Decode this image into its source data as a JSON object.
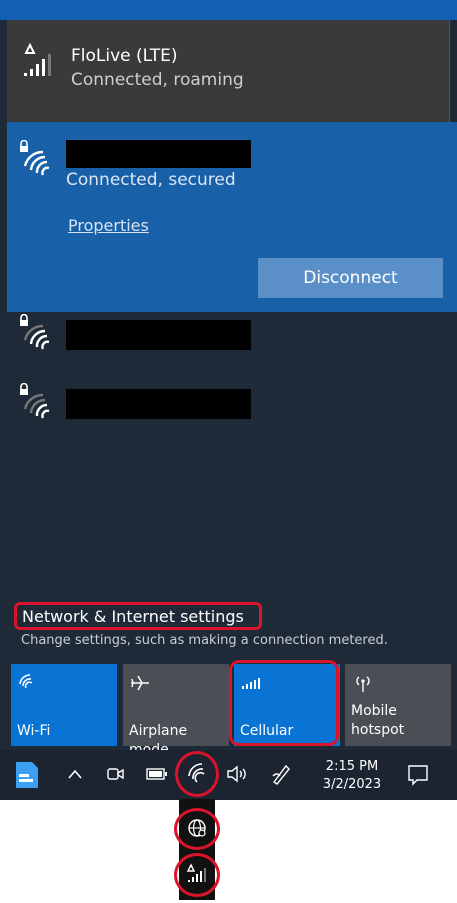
{
  "cellular_connection": {
    "name": "FloLive (LTE)",
    "status": "Connected, roaming"
  },
  "wifi_active": {
    "status": "Connected, secured",
    "properties_link": "Properties",
    "disconnect_label": "Disconnect"
  },
  "network_settings": {
    "title": "Network & Internet settings",
    "subtitle": "Change settings, such as making a connection metered."
  },
  "quick_actions": [
    {
      "label": "Wi-Fi",
      "icon": "wifi-icon",
      "active": true
    },
    {
      "label": "Airplane mode",
      "icon": "airplane-icon",
      "active": false
    },
    {
      "label": "Cellular",
      "icon": "cellular-signal-icon",
      "active": true
    },
    {
      "label": "Mobile hotspot",
      "icon": "mobile-hotspot-icon",
      "active": false
    }
  ],
  "taskbar": {
    "time": "2:15 PM",
    "date": "3/2/2023"
  },
  "colors": {
    "flyout_bg": "#1f2a38",
    "active_wifi_bg": "#1860a8",
    "tile_active": "#0a74d4",
    "tile_inactive": "#4b4f55",
    "highlight_red": "#d9142b"
  }
}
